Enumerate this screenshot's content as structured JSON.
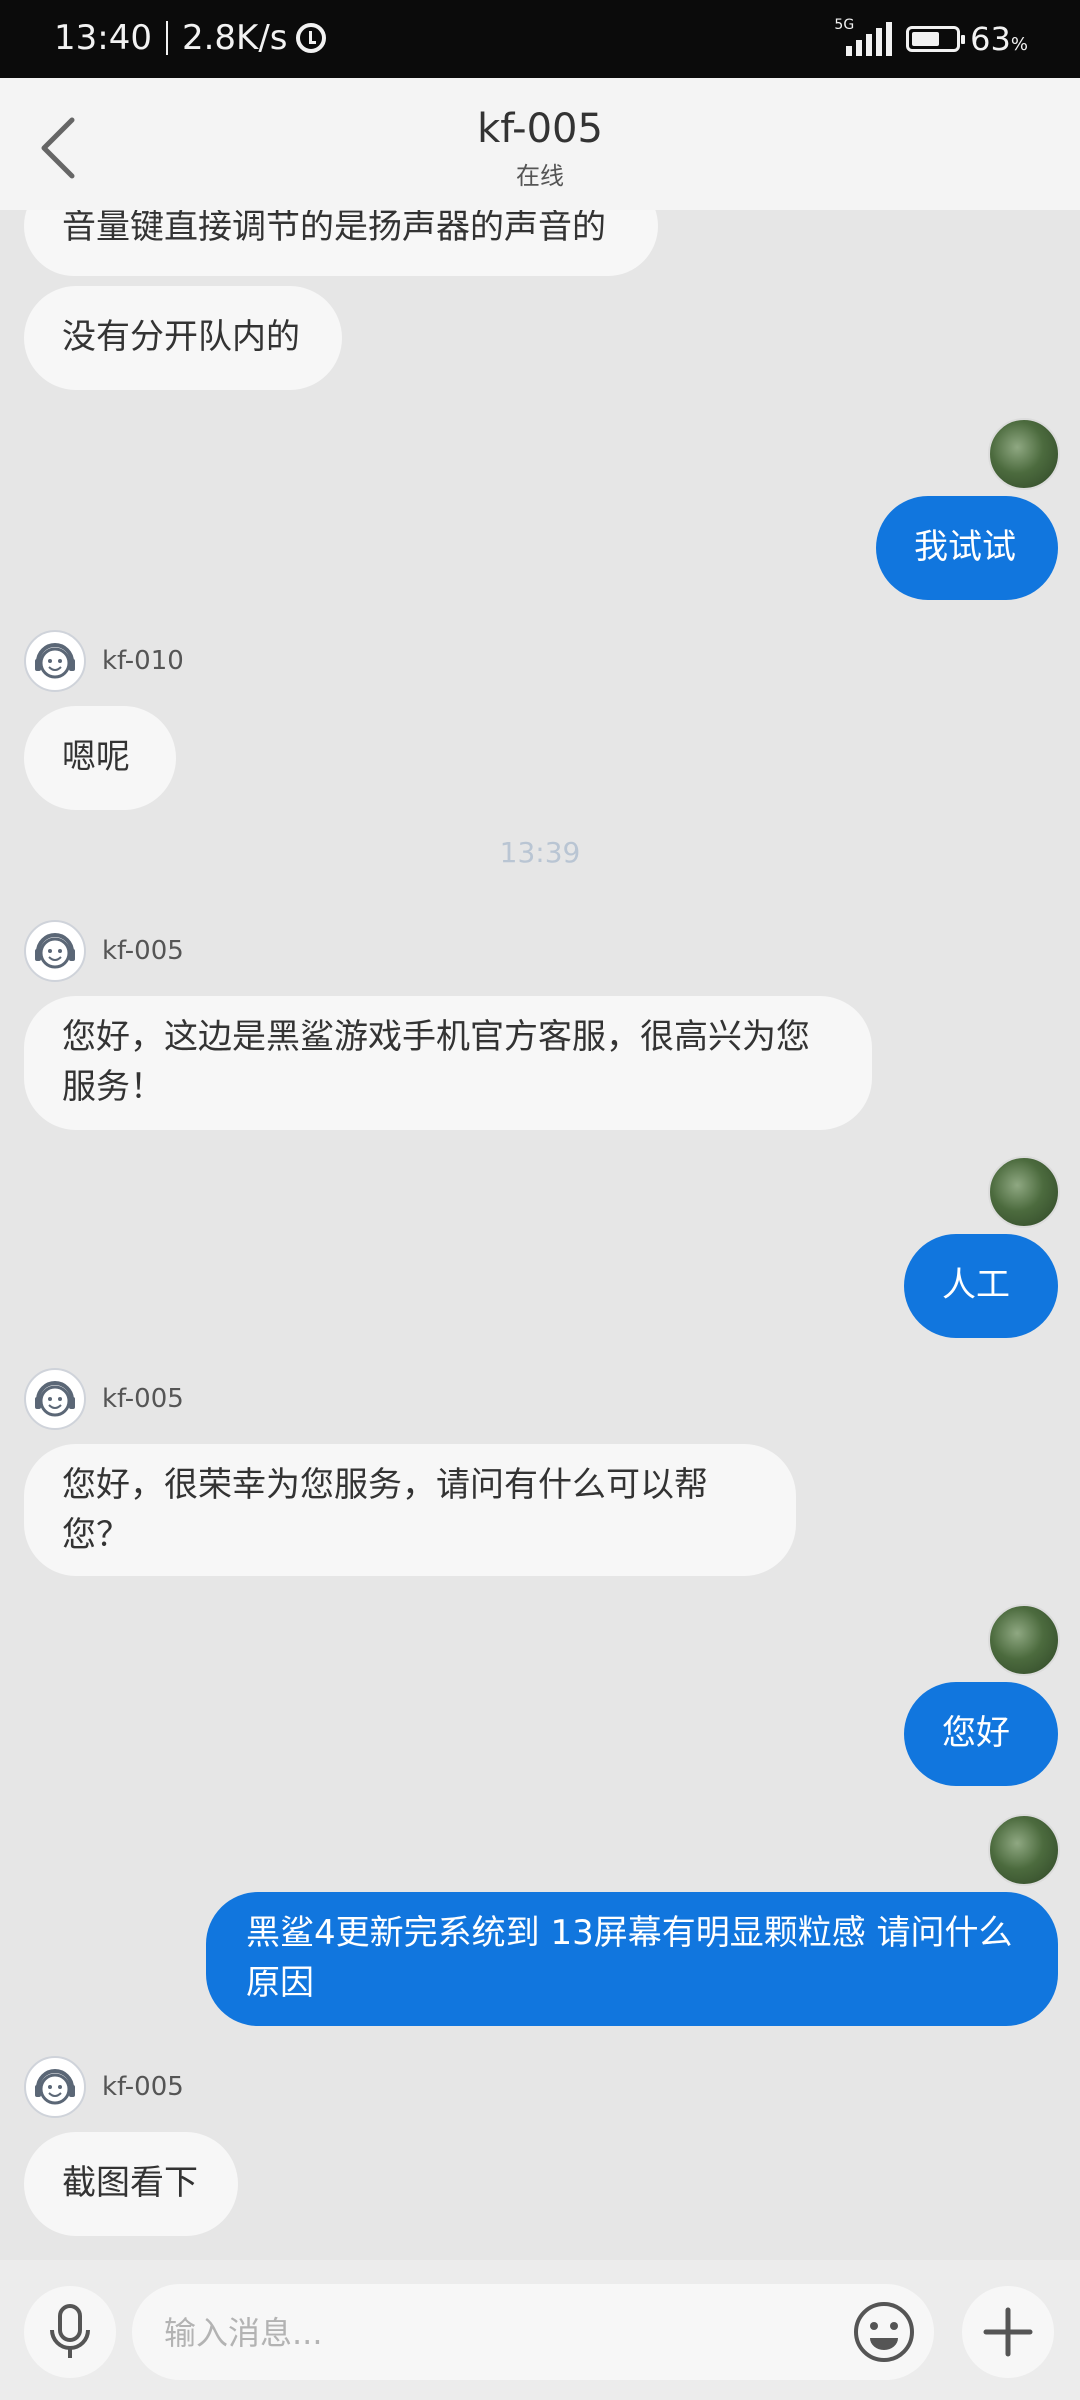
{
  "status_bar": {
    "time": "13:40",
    "net_speed": "2.8K/s",
    "network": "5G",
    "battery_percent": "63",
    "battery_unit": "%",
    "battery_level": 0.63
  },
  "header": {
    "title": "kf-005",
    "subtitle": "在线"
  },
  "messages": [
    {
      "text": "音量键直接调节的是扬声器的声音的"
    },
    {
      "text": "没有分开队内的"
    },
    {
      "text": "我试试"
    },
    {
      "agent": "kf-010",
      "text": "嗯呢"
    },
    {
      "timestamp": "13:39"
    },
    {
      "agent": "kf-005",
      "text": "您好，这边是黑鲨游戏手机官方客服，很高兴为您服务！"
    },
    {
      "text": "人工"
    },
    {
      "agent": "kf-005",
      "text": "您好，很荣幸为您服务，请问有什么可以帮您？"
    },
    {
      "text": "您好"
    },
    {
      "text": "黑鲨4更新完系统到 13屏幕有明显颗粒感 请问什么原因"
    },
    {
      "agent": "kf-005",
      "text": "截图看下"
    }
  ],
  "input": {
    "placeholder": "输入消息..."
  },
  "icons": {
    "back": "chevron-left-icon",
    "mic": "microphone-icon",
    "emoji": "emoji-icon",
    "plus": "plus-icon"
  },
  "colors": {
    "outgoing_bubble": "#1176de",
    "incoming_bubble": "#f7f7f7",
    "background": "#e6e6e6"
  }
}
